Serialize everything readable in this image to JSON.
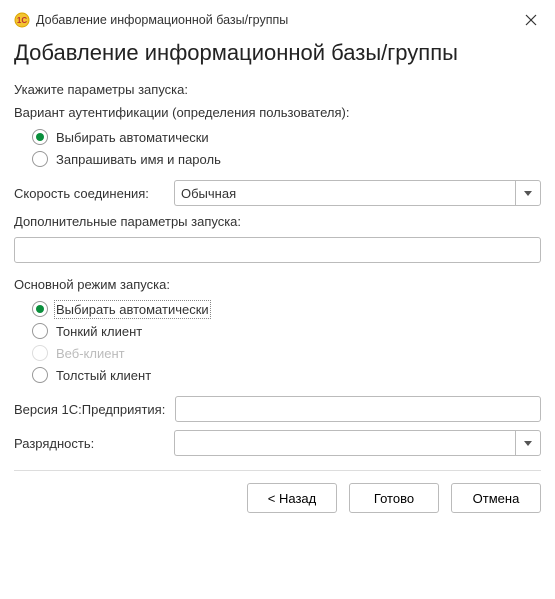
{
  "window": {
    "title": "Добавление информационной базы/группы"
  },
  "page": {
    "heading": "Добавление информационной базы/группы",
    "subheading": "Укажите параметры запуска:"
  },
  "auth": {
    "label": "Вариант аутентификации (определения пользователя):",
    "options": {
      "auto": "Выбирать автоматически",
      "prompt": "Запрашивать имя и пароль"
    }
  },
  "speed": {
    "label": "Скорость соединения:",
    "value": "Обычная"
  },
  "extra": {
    "label": "Дополнительные параметры запуска:",
    "value": ""
  },
  "mode": {
    "label": "Основной режим запуска:",
    "options": {
      "auto": "Выбирать автоматически",
      "thin": "Тонкий клиент",
      "web": "Веб-клиент",
      "thick": "Толстый клиент"
    }
  },
  "version": {
    "label": "Версия 1С:Предприятия:",
    "value": ""
  },
  "bitness": {
    "label": "Разрядность:",
    "value": ""
  },
  "buttons": {
    "back": "< Назад",
    "finish": "Готово",
    "cancel": "Отмена"
  }
}
